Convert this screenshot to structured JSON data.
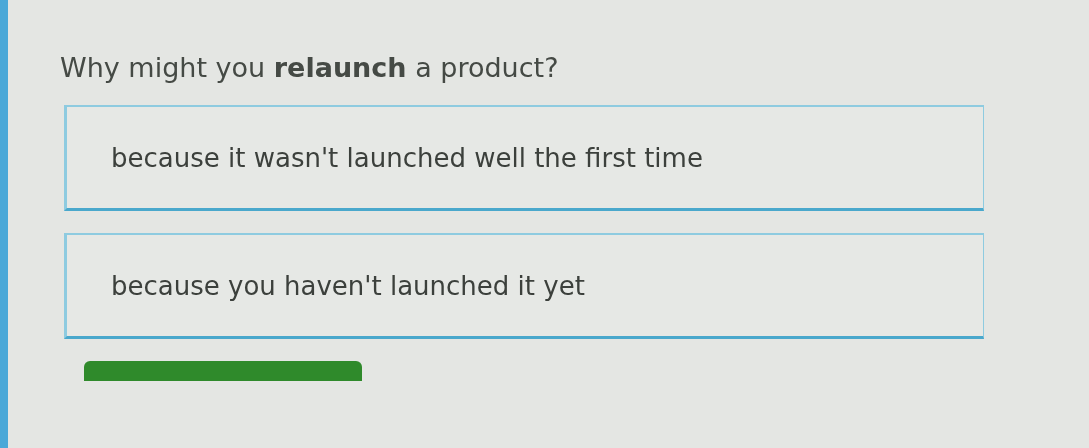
{
  "question": "Why might you **relaunch** a product?",
  "options": [
    {
      "text": "because it wasn't launched well the first time",
      "selected": false
    },
    {
      "text": "because you haven't launched it yet",
      "selected": false
    }
  ]
}
